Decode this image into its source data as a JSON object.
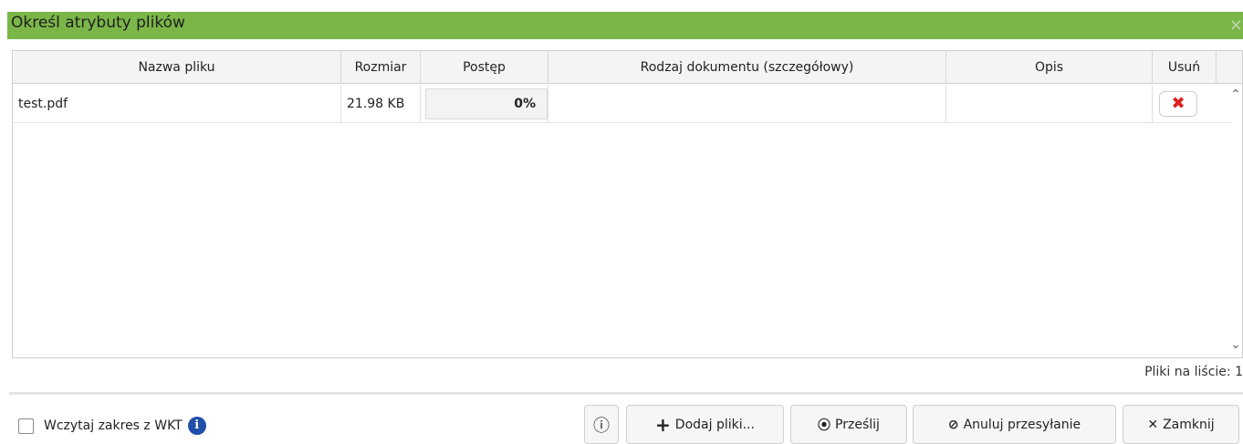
{
  "dialog": {
    "title": "Określ atrybuty plików",
    "close_glyph": "×"
  },
  "table": {
    "columns": [
      "Nazwa pliku",
      "Rozmiar",
      "Postęp",
      "Rodzaj dokumentu (szczegółowy)",
      "Opis",
      "Usuń"
    ],
    "rows": [
      {
        "name": "test.pdf",
        "size": "21.98 KB",
        "progress_label": "0%",
        "progress_value": 0,
        "doc_type": "",
        "description": "",
        "delete_glyph": "✖"
      }
    ]
  },
  "footer": {
    "file_count_label": "Pliki na liście: 1",
    "checkbox_label": "Wczytaj zakres z WKT",
    "checkbox_checked": false,
    "info_glyph": "i",
    "buttons": {
      "info_glyph": "ⓘ",
      "add_icon": "+",
      "add_label": "Dodaj pliki...",
      "upload_icon": "⦿",
      "upload_label": "Prześlij",
      "cancel_icon": "⊘",
      "cancel_label": "Anuluj przesyłanie",
      "close_icon": "✕",
      "close_label": "Zamknij"
    }
  },
  "colors": {
    "titlebar": "#7ab648",
    "delete_icon": "#e02020",
    "info_badge": "#1f4fa8"
  }
}
